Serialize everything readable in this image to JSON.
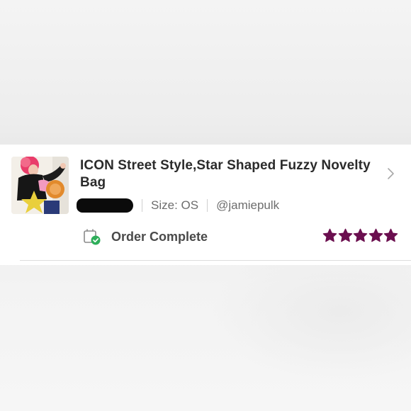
{
  "listing": {
    "title": "ICON Street Style,Star Shaped Fuzzy Novelty Bag",
    "size_label": "Size: OS",
    "username": "@jamiepulk",
    "status": "Order Complete",
    "rating": {
      "value": 5,
      "max": 5
    }
  },
  "icons": {
    "chevron": "chevron-right-icon",
    "status": "order-complete-icon",
    "star": "star-icon"
  },
  "colors": {
    "star": "#6b0f4f",
    "status_check": "#2eae5a",
    "redaction": "#0b0b0b"
  }
}
